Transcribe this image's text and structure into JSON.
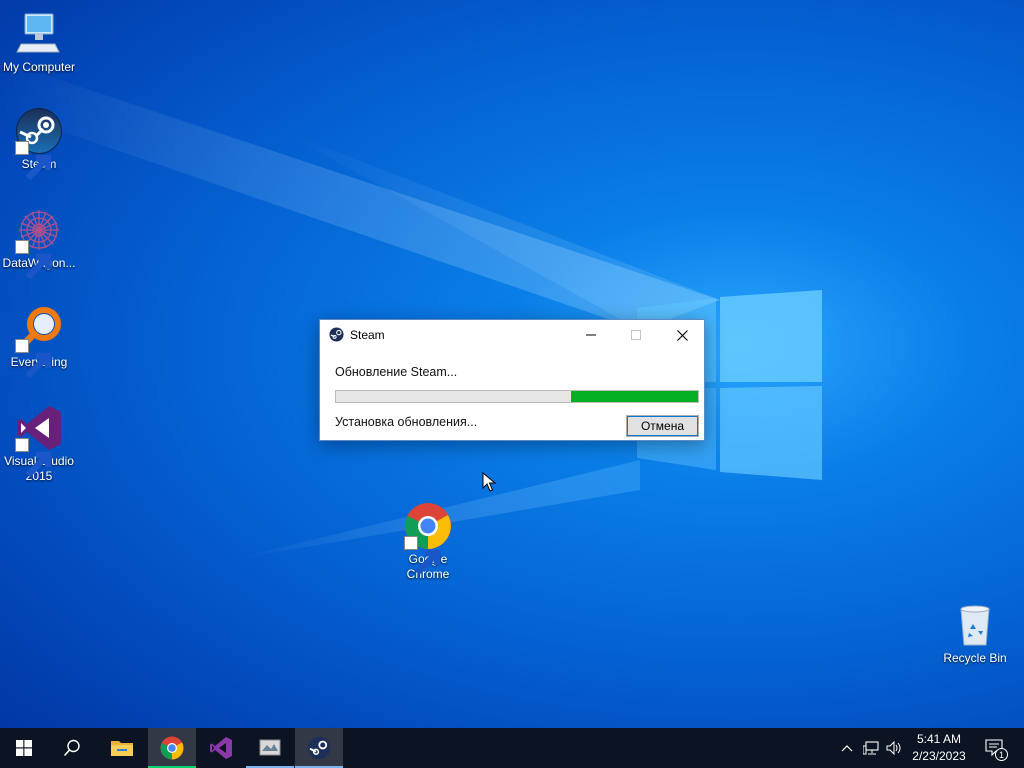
{
  "desktop": {
    "icons": [
      {
        "label": "My Computer",
        "icon": "computer-icon"
      },
      {
        "label": "Steam",
        "icon": "steam-icon"
      },
      {
        "label": "DataWagon...",
        "icon": "datawagon-icon"
      },
      {
        "label": "Everything",
        "icon": "everything-icon"
      },
      {
        "label": "Visual Studio 2015",
        "icon": "visual-studio-icon"
      },
      {
        "label": "Google Chrome",
        "icon": "chrome-icon"
      },
      {
        "label": "Recycle Bin",
        "icon": "recycle-bin-icon"
      }
    ]
  },
  "dialog": {
    "title": "Steam",
    "status": "Обновление Steam...",
    "substatus": "Установка обновления...",
    "cancel_label": "Отмена",
    "progress_fraction": 0.35,
    "progress_color": "#06b025"
  },
  "taskbar": {
    "apps": [
      "start",
      "search",
      "file-explorer",
      "chrome",
      "visual-studio",
      "datawagon",
      "steam"
    ],
    "clock": {
      "time": "5:41 AM",
      "date": "2/23/2023"
    },
    "notification_count": "1"
  }
}
